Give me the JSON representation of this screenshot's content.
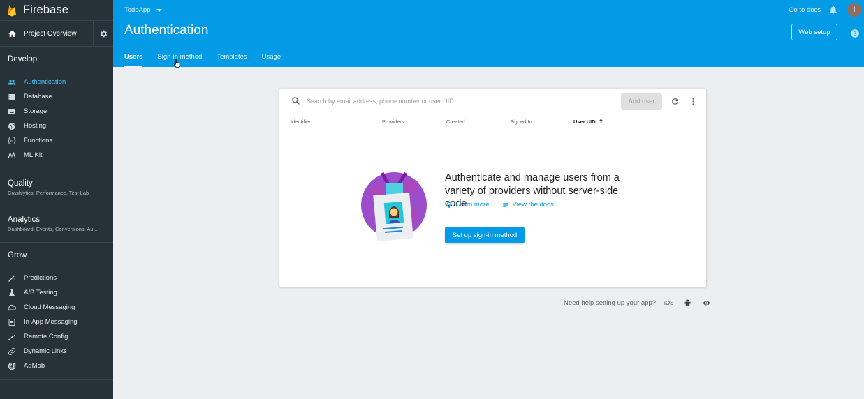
{
  "brand": {
    "name": "Firebase"
  },
  "sidebar": {
    "overview_label": "Project Overview",
    "develop": {
      "heading": "Develop",
      "items": [
        {
          "label": "Authentication",
          "icon": "people-icon",
          "active": true
        },
        {
          "label": "Database",
          "icon": "database-icon"
        },
        {
          "label": "Storage",
          "icon": "storage-icon"
        },
        {
          "label": "Hosting",
          "icon": "globe-icon"
        },
        {
          "label": "Functions",
          "icon": "functions-icon"
        },
        {
          "label": "ML Kit",
          "icon": "mlkit-icon"
        }
      ]
    },
    "quality": {
      "heading": "Quality",
      "sub": "Crashlytics, Performance, Test Lab"
    },
    "analytics": {
      "heading": "Analytics",
      "sub": "Dashboard, Events, Conversions, Au..."
    },
    "grow": {
      "heading": "Grow",
      "items": [
        {
          "label": "Predictions",
          "icon": "predictions-icon"
        },
        {
          "label": "A/B Testing",
          "icon": "flask-icon"
        },
        {
          "label": "Cloud Messaging",
          "icon": "cloud-icon"
        },
        {
          "label": "In-App Messaging",
          "icon": "inapp-message-icon"
        },
        {
          "label": "Remote Config",
          "icon": "remote-config-icon"
        },
        {
          "label": "Dynamic Links",
          "icon": "link-icon"
        },
        {
          "label": "AdMob",
          "icon": "admob-icon"
        }
      ]
    }
  },
  "header": {
    "project": "TodoApp",
    "title": "Authentication",
    "go_to_docs": "Go to docs",
    "avatar_letter": "I",
    "web_setup": "Web setup",
    "tabs": [
      {
        "label": "Users",
        "active": true
      },
      {
        "label": "Sign-in method"
      },
      {
        "label": "Templates"
      },
      {
        "label": "Usage"
      }
    ]
  },
  "users_card": {
    "search_placeholder": "Search by email address, phone number or user UID",
    "add_user": "Add user",
    "columns": [
      "Identifier",
      "Providers",
      "Created",
      "Signed In",
      "User UID"
    ],
    "empty_message": "Authenticate and manage users from a variety of providers without server-side code",
    "learn_more": "Learn more",
    "view_docs": "View the docs",
    "setup_button": "Set up sign-in method"
  },
  "footer_help": {
    "text": "Need help setting up your app?",
    "ios": "iOS"
  },
  "colors": {
    "header": "#039be5",
    "sidebar": "#263238",
    "active": "#4fc3f7",
    "background": "#eceff1"
  }
}
